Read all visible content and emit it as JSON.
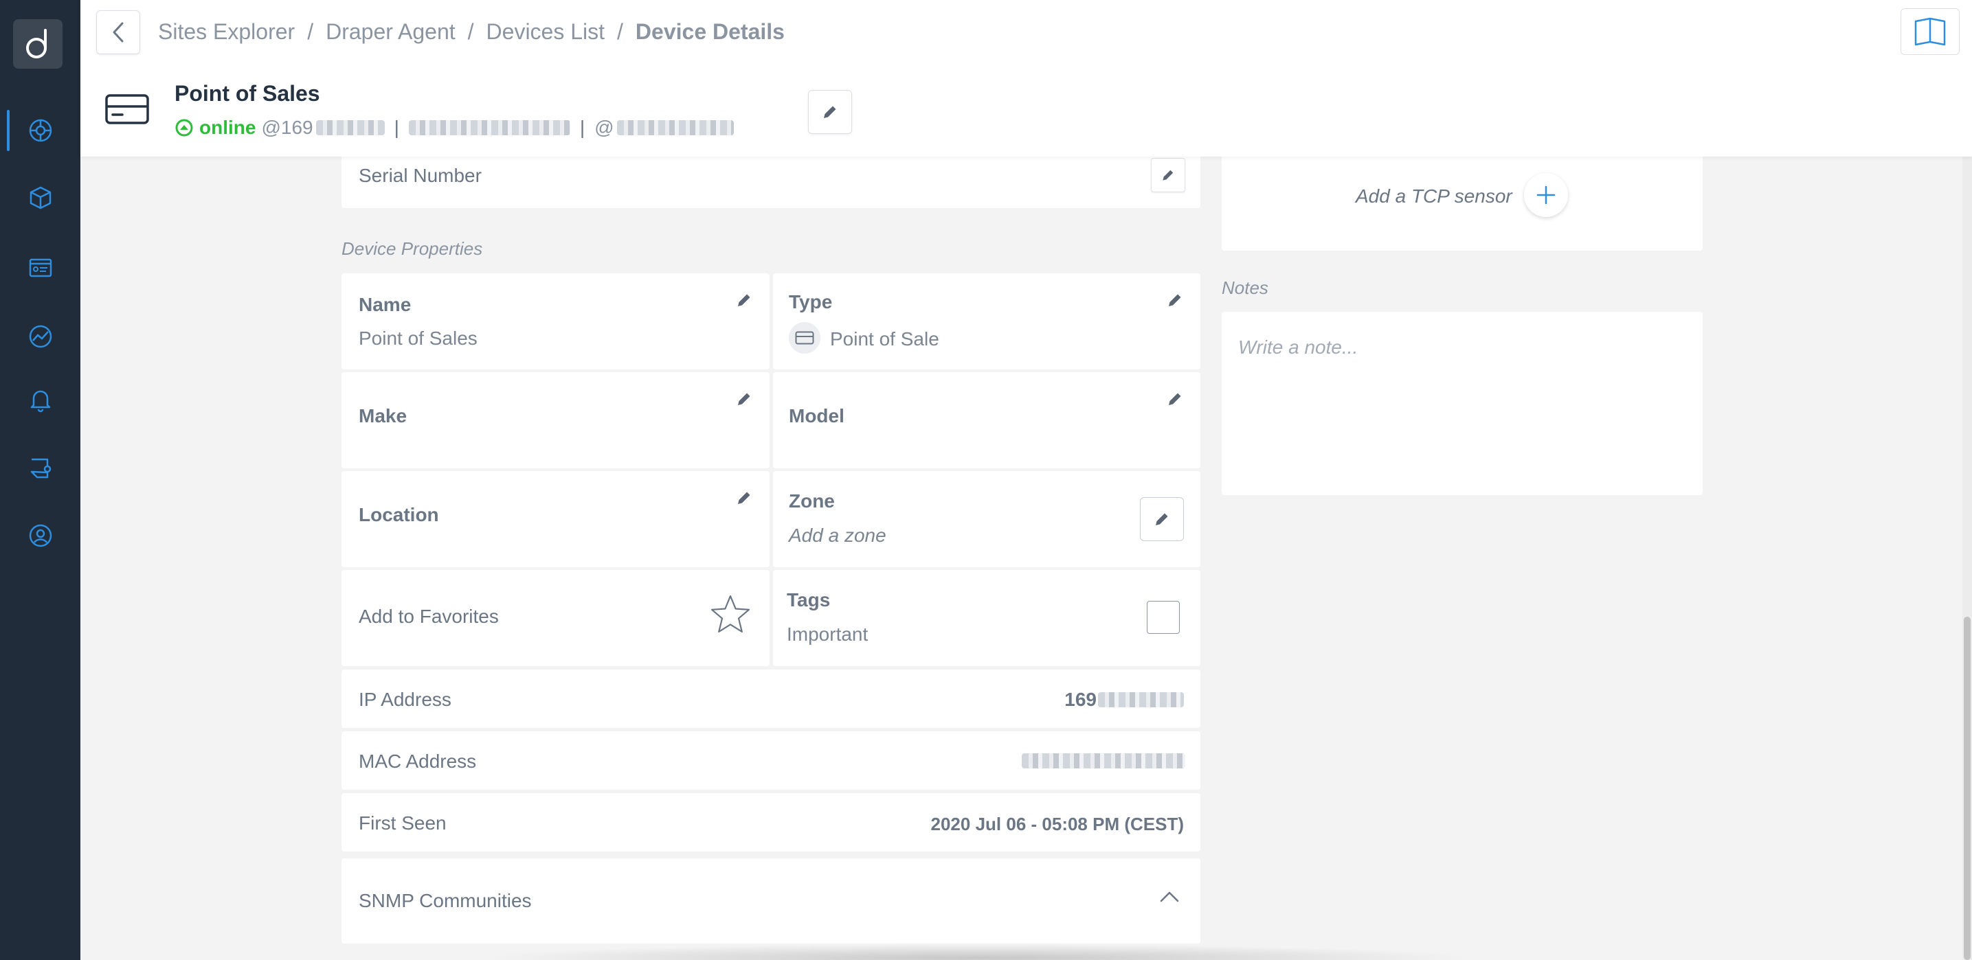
{
  "breadcrumb": {
    "items": [
      "Sites Explorer",
      "Draper Agent",
      "Devices List"
    ],
    "current": "Device Details",
    "separator": "/"
  },
  "device": {
    "title": "Point of Sales",
    "status": "online",
    "ip_prefix": "@169",
    "at_symbol": "@",
    "pipe": "|"
  },
  "serial": {
    "label": "Serial Number"
  },
  "properties": {
    "section_label": "Device Properties",
    "name_label": "Name",
    "name_value": "Point of Sales",
    "type_label": "Type",
    "type_value": "Point of Sale",
    "make_label": "Make",
    "model_label": "Model",
    "location_label": "Location",
    "zone_label": "Zone",
    "zone_placeholder": "Add a zone",
    "favorites_label": "Add to Favorites",
    "tags_label": "Tags",
    "tags_value": "Important"
  },
  "details": {
    "ip_label": "IP Address",
    "ip_value": "169",
    "mac_label": "MAC Address",
    "first_seen_label": "First Seen",
    "first_seen_value": "2020 Jul 06 - 05:08 PM (CEST)",
    "snmp_label": "SNMP Communities"
  },
  "tcp": {
    "label": "Add a TCP sensor"
  },
  "notes": {
    "section_label": "Notes",
    "placeholder": "Write a note..."
  },
  "colors": {
    "sidebar": "#212c3a",
    "accent": "#2d8ee0",
    "online": "#2ebd3a",
    "background": "#f3f3f3"
  },
  "icons": {
    "logo": "d-logo",
    "nav": [
      "globe-icon",
      "cube-icon",
      "dashboard-icon",
      "chart-icon",
      "bell-icon",
      "settings-icon",
      "user-icon"
    ]
  }
}
